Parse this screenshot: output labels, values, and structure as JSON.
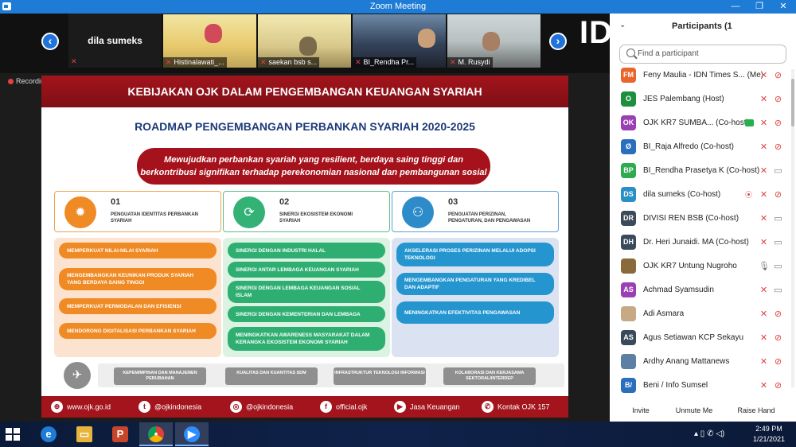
{
  "window": {
    "title": "Zoom Meeting",
    "controls": [
      "—",
      "❐",
      "✕"
    ]
  },
  "gallery": {
    "active_speaker_name": "dila sumeks",
    "prev_icon": "chevron-left-icon",
    "next_icon": "chevron-right-icon",
    "side_logo": "ID",
    "tiles": [
      {
        "name": "Histinalawati_..."
      },
      {
        "name": "saekan bsb s..."
      },
      {
        "name": "BI_Rendha Pr..."
      },
      {
        "name": "M. Rusydi"
      }
    ]
  },
  "recording_label": "Recording",
  "slide": {
    "header": "KEBIJAKAN OJK DALAM PENGEMBANGAN KEUANGAN SYARIAH",
    "title": "ROADMAP PENGEMBANGAN PERBANKAN SYARIAH 2020-2025",
    "vision_line1": "Mewujudkan perbankan syariah yang resilient, berdaya saing tinggi dan",
    "vision_line2": "berkontribusi signifikan terhadap perekonomian nasional dan pembangunan sosial",
    "pillars": [
      {
        "num": "01",
        "label": "PENGUATAN IDENTITAS PERBANKAN SYARIAH",
        "color": "#ef8a24"
      },
      {
        "num": "02",
        "label": "SINERGI EKOSISTEM EKONOMI SYARIAH",
        "color": "#34b276"
      },
      {
        "num": "03",
        "label": "PENGUATAN PERIZINAN, PENGATURAN, DAN PENGAWASAN",
        "color": "#2e8bc9"
      }
    ],
    "col1": [
      "MEMPERKUAT NILAI-NILAI SYARIAH",
      "MENGEMBANGKAN KEUNIKAN PRODUK SYARIAH YANG BERDAYA SAING TINGGI",
      "MEMPERKUAT PERMODALAN DAN EFISIENSI",
      "MENDORONG DIGITALISASI PERBANKAN SYARIAH"
    ],
    "col2": [
      "SINERGI DENGAN INDUSTRI HALAL",
      "SINERGI ANTAR LEMBAGA KEUANGAN SYARIAH",
      "SINERGI DENGAN LEMBAGA KEUANGAN SOSIAL ISLAM",
      "SINERGI DENGAN KEMENTERIAN DAN LEMBAGA",
      "MENINGKATKAN AWARENESS MASYARAKAT DALAM KERANGKA EKOSISTEM EKONOMI SYARIAH"
    ],
    "col3": [
      "AKSELERASI PROSES PERIZINAN MELALUI ADOPSI TEKNOLOGI",
      "MENGEMBANGKAN PENGATURAN YANG KREDIBEL DAN ADAPTIF",
      "MENINGKATKAN EFEKTIVITAS PENGAWASAN"
    ],
    "enablers": [
      "KEPEMIMPINAN DAN MANAJEMEN PERUBAHAN",
      "KUALITAS DAN KUANTITAS SDM",
      "INFRASTRUKTUR TEKNOLOGI INFORMASI",
      "KOLABORASI DAN KERJASAMA SEKTORAL/INTERDEP"
    ],
    "footer": [
      {
        "icon": "globe-icon",
        "glyph": "⊕",
        "text": "www.ojk.go.id"
      },
      {
        "icon": "twitter-icon",
        "glyph": "t",
        "text": "@ojkindonesia"
      },
      {
        "icon": "instagram-icon",
        "glyph": "◎",
        "text": "@ojkindonesia"
      },
      {
        "icon": "facebook-icon",
        "glyph": "f",
        "text": "official.ojk"
      },
      {
        "icon": "youtube-icon",
        "glyph": "▶",
        "text": "Jasa Keuangan"
      },
      {
        "icon": "phone-icon",
        "glyph": "✆",
        "text": "Kontak OJK 157"
      }
    ]
  },
  "participants": {
    "title": "Participants (1",
    "search_placeholder": "Find a participant",
    "list": [
      {
        "initials": "FM",
        "color": "#e8652b",
        "name": "Feny Maulia - IDN Times S... (Me)",
        "mic": "muted",
        "video": "off"
      },
      {
        "initials": "O",
        "color": "#1e8f3e",
        "name": "JES Palembang (Host)",
        "mic": "muted",
        "video": "off"
      },
      {
        "initials": "OK",
        "color": "#9b3fb4",
        "name": "OJK KR7 SUMBA... (Co-host)",
        "mic": "muted",
        "video": "off",
        "share": true
      },
      {
        "initials": "Ø",
        "color": "#2a6fbd",
        "name": "BI_Raja Alfredo (Co-host)",
        "mic": "muted",
        "video": "off"
      },
      {
        "initials": "BP",
        "color": "#2eaa50",
        "name": "BI_Rendha Prasetya K (Co-host)",
        "mic": "muted",
        "video": "on"
      },
      {
        "initials": "DS",
        "color": "#2a8fc7",
        "name": "dila sumeks (Co-host)",
        "mic": "muted",
        "video": "off",
        "record": true
      },
      {
        "initials": "DR",
        "color": "#3a4a5a",
        "name": "DIVISI REN BSB (Co-host)",
        "mic": "muted",
        "video": "on"
      },
      {
        "initials": "DH",
        "color": "#3a4a5a",
        "name": "Dr. Heri Junaidi. MA (Co-host)",
        "mic": "muted",
        "video": "on"
      },
      {
        "initials": "",
        "color": "#8a6a3a",
        "name": "OJK KR7 Untung Nugroho",
        "mic": "on",
        "video": "on"
      },
      {
        "initials": "AS",
        "color": "#9b3fb4",
        "name": "Achmad Syamsudin",
        "mic": "muted",
        "video": "on"
      },
      {
        "initials": "",
        "color": "#c7a984",
        "name": "Adi Asmara",
        "mic": "muted",
        "video": "off"
      },
      {
        "initials": "AS",
        "color": "#3a4a5a",
        "name": "Agus Setiawan KCP Sekayu",
        "mic": "muted",
        "video": "off"
      },
      {
        "initials": "",
        "color": "#5d7fa6",
        "name": "Ardhy Anang Mattanews",
        "mic": "muted",
        "video": "off"
      },
      {
        "initials": "B/",
        "color": "#2a6fbd",
        "name": "Beni / Info Sumsel",
        "mic": "muted",
        "video": "off"
      }
    ],
    "buttons": [
      "Invite",
      "Unmute Me",
      "Raise Hand"
    ]
  },
  "taskbar": {
    "apps": [
      "windows-start",
      "internet-explorer",
      "file-explorer",
      "powerpoint",
      "chrome",
      "zoom"
    ],
    "time": "2:49 PM",
    "date": "1/21/2021",
    "tray": "▴   ▯  ✆  ◁)"
  }
}
